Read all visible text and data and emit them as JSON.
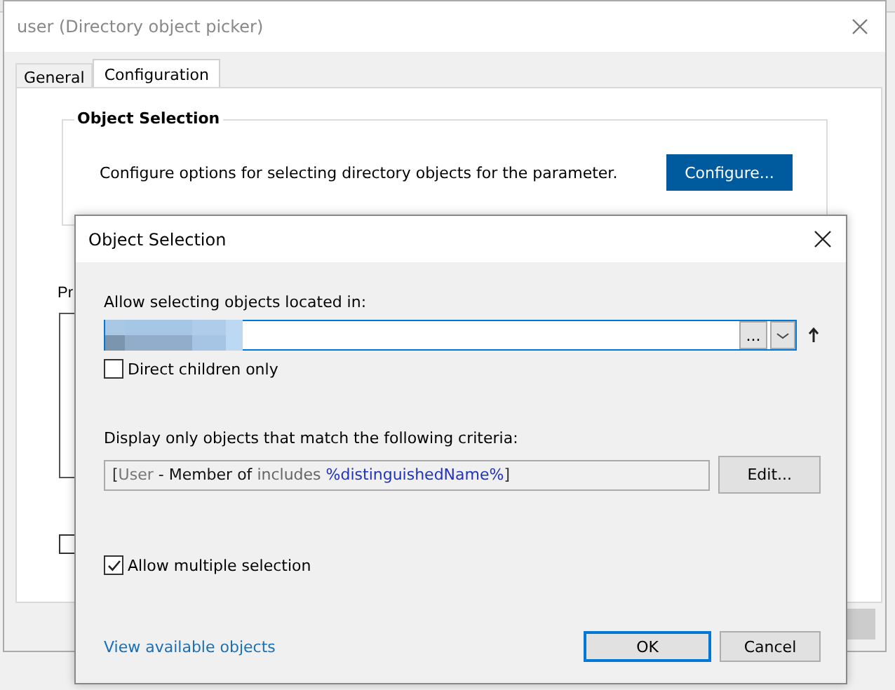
{
  "window": {
    "title": "user (Directory object picker)"
  },
  "tabs": [
    {
      "label": "General",
      "selected": false
    },
    {
      "label": "Configuration",
      "selected": true
    }
  ],
  "object_selection": {
    "title": "Object Selection",
    "description": "Configure options for selecting directory objects for the parameter.",
    "button": "Configure..."
  },
  "behind": {
    "list_label": "Pr",
    "checkbox_checked": false
  },
  "dialog": {
    "title": "Object Selection",
    "location_label": "Allow selecting objects located in:",
    "browse_button": "...",
    "direct_children": {
      "label": "Direct children only",
      "checked": false
    },
    "criteria_label": "Display only objects that match the following criteria:",
    "criteria": [
      {
        "kind": "bracket",
        "text": "["
      },
      {
        "kind": "object",
        "text": "User"
      },
      {
        "kind": "property",
        "text": " - Member of "
      },
      {
        "kind": "operator",
        "text": "includes "
      },
      {
        "kind": "value",
        "text": "%distinguishedName%"
      },
      {
        "kind": "bracket",
        "text": "]"
      }
    ],
    "edit_button": "Edit...",
    "multiple": {
      "label": "Allow multiple selection",
      "checked": true
    },
    "link": "View available objects",
    "buttons": [
      {
        "label": "OK",
        "default": true
      },
      {
        "label": "Cancel",
        "default": false
      }
    ]
  }
}
